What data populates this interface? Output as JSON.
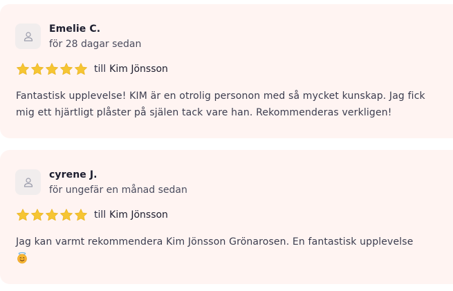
{
  "reviews": [
    {
      "author": "Emelie C.",
      "time": "för 28 dagar sedan",
      "rating": 5,
      "to_prefix": "till",
      "to_name": "Kim Jönsson",
      "text": "Fantastisk upplevelse! KIM är en otrolig personon med så mycket kunskap. Jag fick mig ett hjärtligt plåster på själen tack vare han. Rekommenderas verkligen!",
      "emoji": null
    },
    {
      "author": "cyrene J.",
      "time": "för ungefär en månad sedan",
      "rating": 5,
      "to_prefix": "till",
      "to_name": "Kim Jönsson",
      "text": "Jag kan varmt rekommendera Kim Jönsson Grönarosen. En fantastisk upplevelse",
      "emoji": "smiling-face-with-halo-icon"
    }
  ],
  "colors": {
    "card_bg": "#fff4f2",
    "star": "#f6c533",
    "text": "#3a3c4e"
  }
}
